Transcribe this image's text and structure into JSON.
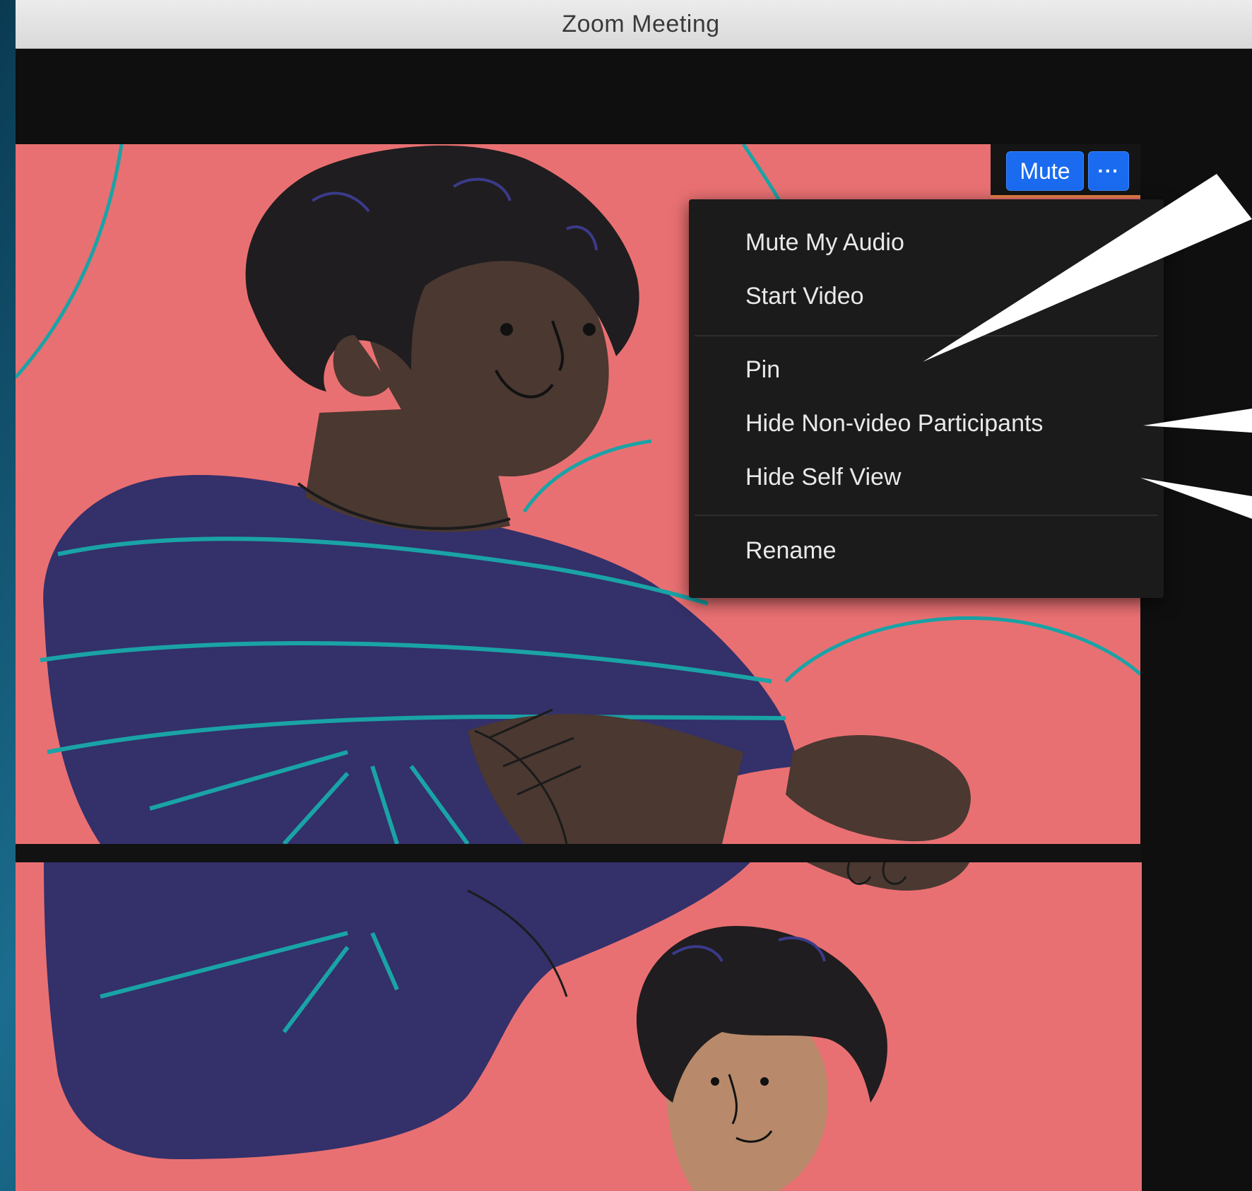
{
  "window": {
    "title": "Zoom Meeting"
  },
  "video_tile": {
    "mute_label": "Mute",
    "more_label": "···"
  },
  "context_menu": {
    "items": [
      {
        "label": "Mute My Audio"
      },
      {
        "label": "Start Video"
      },
      {
        "label": "Pin"
      },
      {
        "label": "Hide Non-video Participants"
      },
      {
        "label": "Hide Self View"
      },
      {
        "label": "Rename"
      }
    ]
  },
  "colors": {
    "accent_blue": "#1a6bf0",
    "tile_background": "#e97072",
    "menu_background": "#1b1b1c",
    "window_background": "#0f0f10"
  }
}
